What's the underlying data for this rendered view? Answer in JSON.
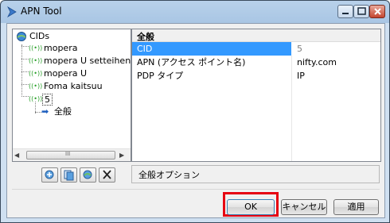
{
  "window": {
    "title": "APN Tool"
  },
  "tree": {
    "root": "CIDs",
    "items": [
      "mopera",
      "mopera U setteihenko",
      "mopera U",
      "Foma kaitsuu",
      "5"
    ],
    "child": "全般"
  },
  "grid": {
    "section": "全般",
    "rows": [
      {
        "key": "CID",
        "value": "5"
      },
      {
        "key": "APN (アクセス ポイント名)",
        "value": "nifty.com"
      },
      {
        "key": "PDP タイプ",
        "value": "IP"
      }
    ]
  },
  "description": "全般オプション",
  "buttons": {
    "ok": "OK",
    "cancel": "キャンセル",
    "apply": "適用"
  },
  "scrollbar": {
    "left_arrow": "◀",
    "right_arrow": "▶",
    "grip": "III"
  },
  "colors": {
    "selection": "#3399ff",
    "highlight_frame": "#e60012"
  }
}
